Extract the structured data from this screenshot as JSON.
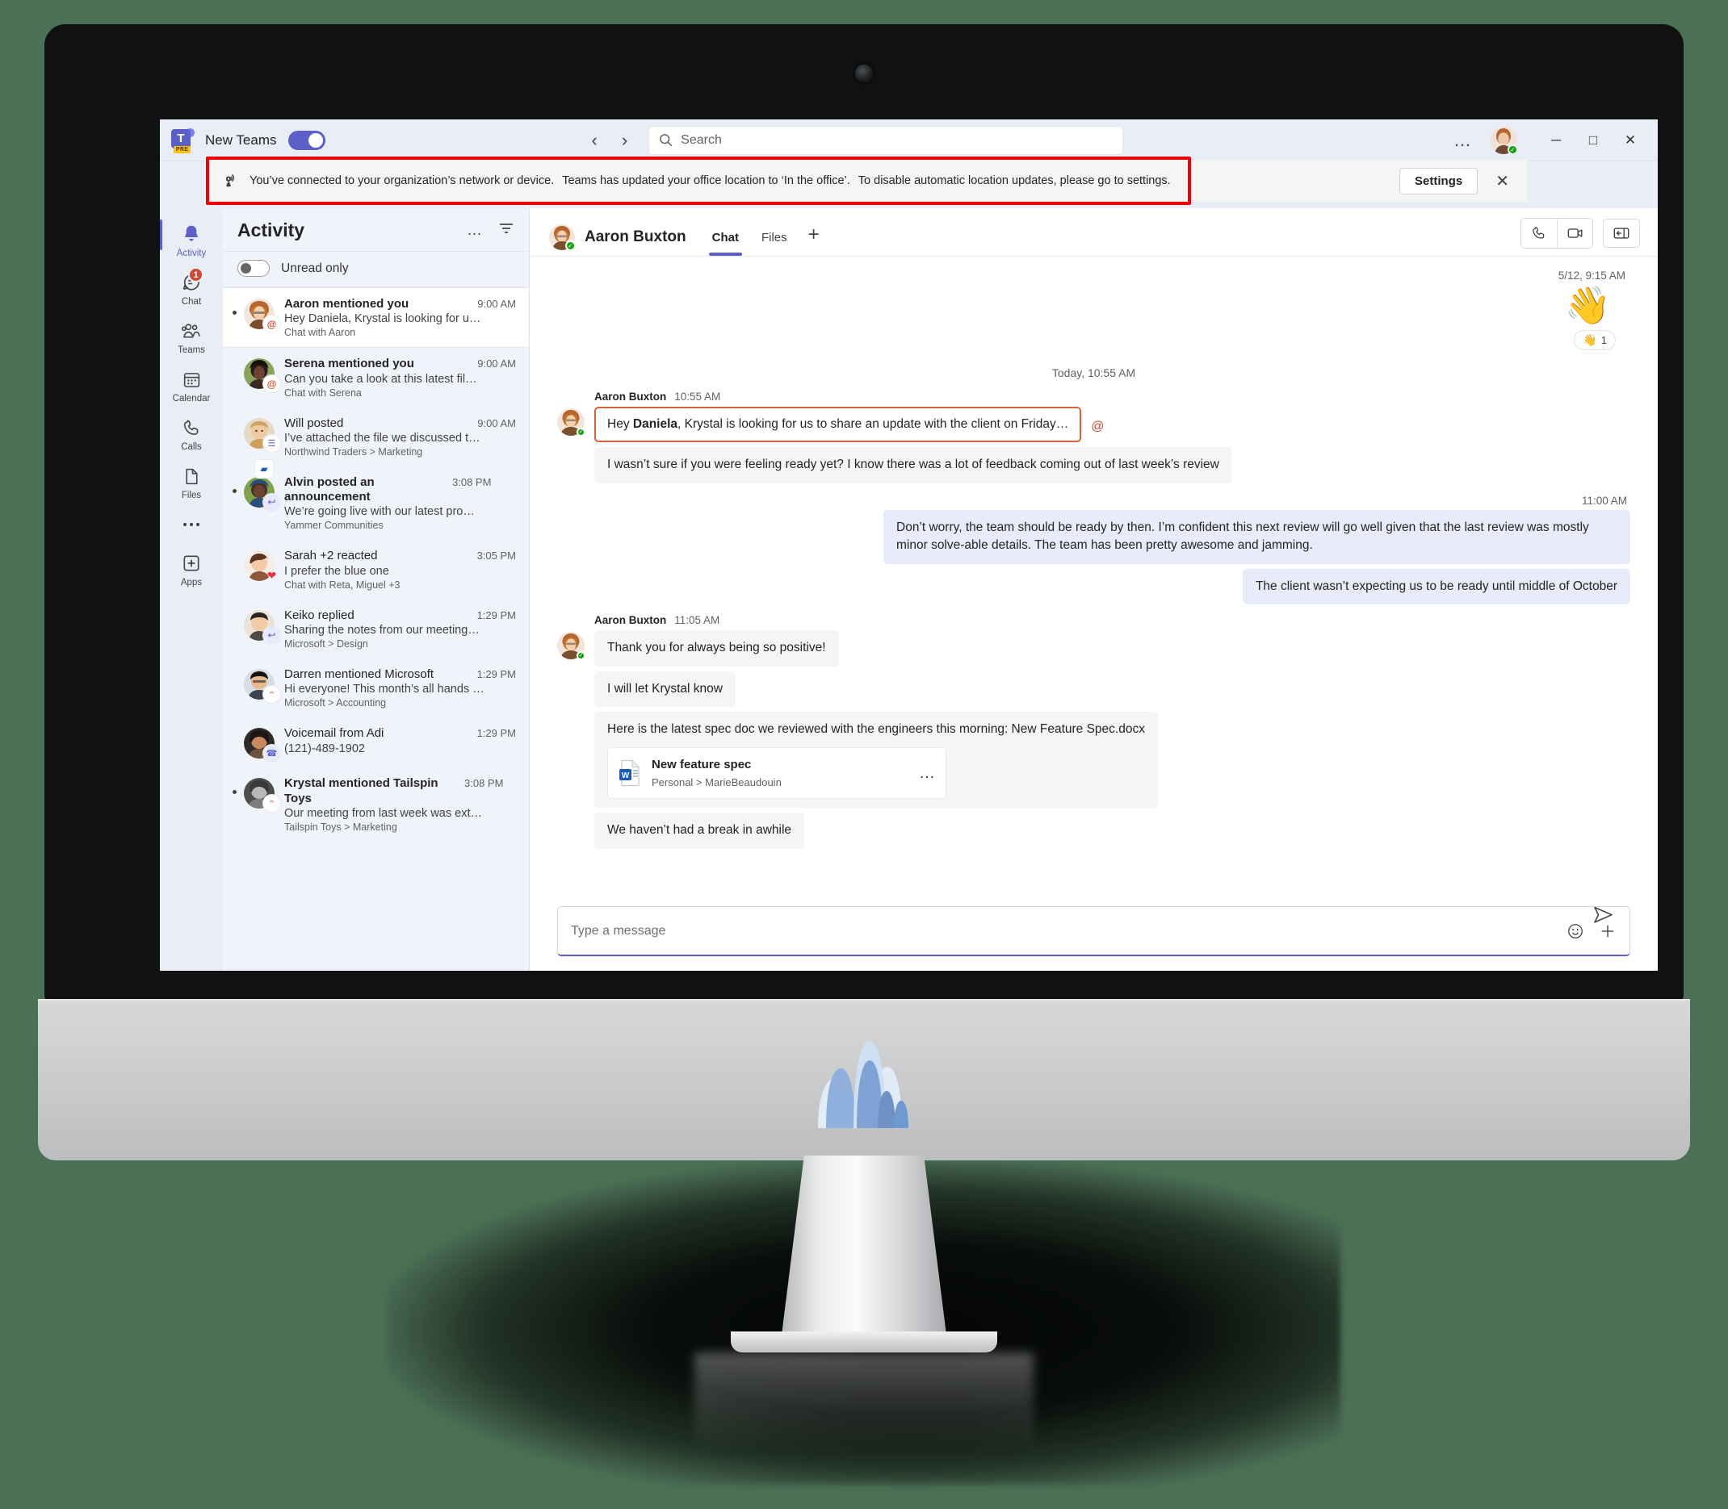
{
  "titlebar": {
    "app_name": "New Teams",
    "app_badge": "PRE",
    "toggle_state": "on",
    "back_arrow": "‹",
    "forward_arrow": "›",
    "search_placeholder": "Search",
    "more_label": "…",
    "minimize": "─",
    "maximize": "□",
    "close": "✕"
  },
  "banner": {
    "icon": "location-broadcast-icon",
    "text_part1": "You’ve connected to your organization’s network or device.",
    "text_part2": "Teams has updated your office location to ‘In the office’.",
    "text_part3": "To disable automatic location updates, please go to settings.",
    "settings_label": "Settings",
    "close": "✕"
  },
  "rail": {
    "items": [
      {
        "label": "Activity",
        "icon": "bell-icon",
        "active": true,
        "badge": ""
      },
      {
        "label": "Chat",
        "icon": "chat-icon",
        "active": false,
        "badge": "1"
      },
      {
        "label": "Teams",
        "icon": "teams-icon",
        "active": false,
        "badge": ""
      },
      {
        "label": "Calendar",
        "icon": "calendar-icon",
        "active": false,
        "badge": ""
      },
      {
        "label": "Calls",
        "icon": "phone-icon",
        "active": false,
        "badge": ""
      },
      {
        "label": "Files",
        "icon": "file-icon",
        "active": false,
        "badge": ""
      },
      {
        "label": "",
        "icon": "more-icon",
        "active": false,
        "badge": ""
      },
      {
        "label": "Apps",
        "icon": "apps-plus-icon",
        "active": false,
        "badge": ""
      }
    ]
  },
  "activity": {
    "title": "Activity",
    "more_label": "…",
    "filter_icon": "filter-icon",
    "unread_label": "Unread only",
    "unread_on": false,
    "items": [
      {
        "title": "Aaron mentioned you",
        "time": "9:00 AM",
        "preview": "Hey Daniela, Krystal is looking for u…",
        "context": "Chat with Aaron",
        "badge": "@",
        "badge_kind": "mention",
        "unread": true,
        "selected": true
      },
      {
        "title": "Serena mentioned you",
        "time": "9:00 AM",
        "preview": "Can you take a look at this latest fil…",
        "context": "Chat with Serena",
        "badge": "@",
        "badge_kind": "mention",
        "unread": true,
        "selected": false
      },
      {
        "title": "Will posted",
        "time": "9:00 AM",
        "preview": "I’ve attached the file we discussed t…",
        "context": "Northwind Traders > Marketing",
        "badge": "☰",
        "badge_kind": "post",
        "unread": false,
        "selected": false
      },
      {
        "title": "Alvin posted an announcement",
        "time": "3:08 PM",
        "preview": "We’re going live with our latest pro…",
        "context": "Yammer Communities",
        "badge": "↩",
        "badge_kind": "reply",
        "unread": true,
        "selected": false
      },
      {
        "title": "Sarah +2 reacted",
        "time": "3:05 PM",
        "preview": "I prefer the blue one",
        "context": "Chat with Reta, Miguel +3",
        "badge": "❤",
        "badge_kind": "heart",
        "unread": false,
        "selected": false
      },
      {
        "title": "Keiko replied",
        "time": "1:29 PM",
        "preview": "Sharing the notes from our meeting…",
        "context": "Microsoft > Design",
        "badge": "↩",
        "badge_kind": "reply",
        "unread": false,
        "selected": false
      },
      {
        "title": "Darren mentioned Microsoft",
        "time": "1:29 PM",
        "preview": "Hi everyone! This month’s all hands …",
        "context": "Microsoft > Accounting",
        "badge": "ᵔ",
        "badge_kind": "team",
        "unread": false,
        "selected": false
      },
      {
        "title": "Voicemail from Adi",
        "time": "1:29 PM",
        "preview": "(121)-489-1902",
        "context": "",
        "badge": "☎",
        "badge_kind": "voicemail",
        "unread": false,
        "selected": false
      },
      {
        "title": "Krystal mentioned Tailspin Toys",
        "time": "3:08 PM",
        "preview": "Our meeting from last week was ext…",
        "context": "Tailspin Toys > Marketing",
        "badge": "ᵔ",
        "badge_kind": "team",
        "unread": true,
        "selected": false
      }
    ]
  },
  "chat": {
    "contact_name": "Aaron Buxton",
    "presence": "available",
    "tabs": [
      {
        "label": "Chat",
        "active": true
      },
      {
        "label": "Files",
        "active": false
      }
    ],
    "add_tab": "+",
    "actions": [
      {
        "name": "audio-call-icon"
      },
      {
        "name": "video-call-icon"
      },
      {
        "name": "open-panel-icon"
      }
    ],
    "old_timestamp": "5/12, 9:15 AM",
    "sticker": "👋",
    "reaction_emoji": "👋",
    "reaction_count": "1",
    "day_separator": "Today, 10:55 AM",
    "groups": [
      {
        "sender": "Aaron Buxton",
        "time": "10:55 AM",
        "side": "left",
        "show_meta": true,
        "bubbles": [
          {
            "text": "Hey Daniela, Krystal is looking for us to share an update with the client on Friday…",
            "bold_word": "Daniela",
            "highlight": true,
            "mention": true
          },
          {
            "text": "I wasn’t sure if you were feeling ready yet? I know there was a lot of feedback coming out of last week’s review",
            "highlight": false,
            "mention": false
          }
        ]
      },
      {
        "sender": "",
        "time": "11:00 AM",
        "side": "right",
        "show_meta": false,
        "bubbles": [
          {
            "text": "Don’t worry, the team should be ready by then. I’m confident this next review will go well given that the last review was mostly minor solve-able details. The team has been pretty awesome and jamming."
          },
          {
            "text": "The client wasn’t expecting us to be ready until middle of October"
          }
        ]
      },
      {
        "sender": "Aaron Buxton",
        "time": "11:05 AM",
        "side": "left",
        "show_meta": true,
        "bubbles": [
          {
            "text": "Thank you for always being so positive!"
          },
          {
            "text": "I will let Krystal know"
          },
          {
            "text": "Here is the latest spec doc we reviewed with the engineers this morning: New Feature Spec.docx",
            "file": {
              "name": "New feature spec",
              "location": "Personal > MarieBeaudouin",
              "icon": "word-icon",
              "more": "…"
            }
          },
          {
            "text": "We haven’t had a break in awhile"
          }
        ]
      }
    ],
    "compose_placeholder": "Type a message",
    "compose_icons": [
      {
        "name": "emoji-icon",
        "glyph": "☺"
      },
      {
        "name": "plus-icon",
        "glyph": "+"
      }
    ],
    "send_icon": "send-icon"
  },
  "colors": {
    "accent": "#5b5fc7",
    "banner_highlight": "#ee0000",
    "mention": "#cc4a31",
    "presence_available": "#13a10e",
    "desktop_bg": "#4c7056"
  }
}
